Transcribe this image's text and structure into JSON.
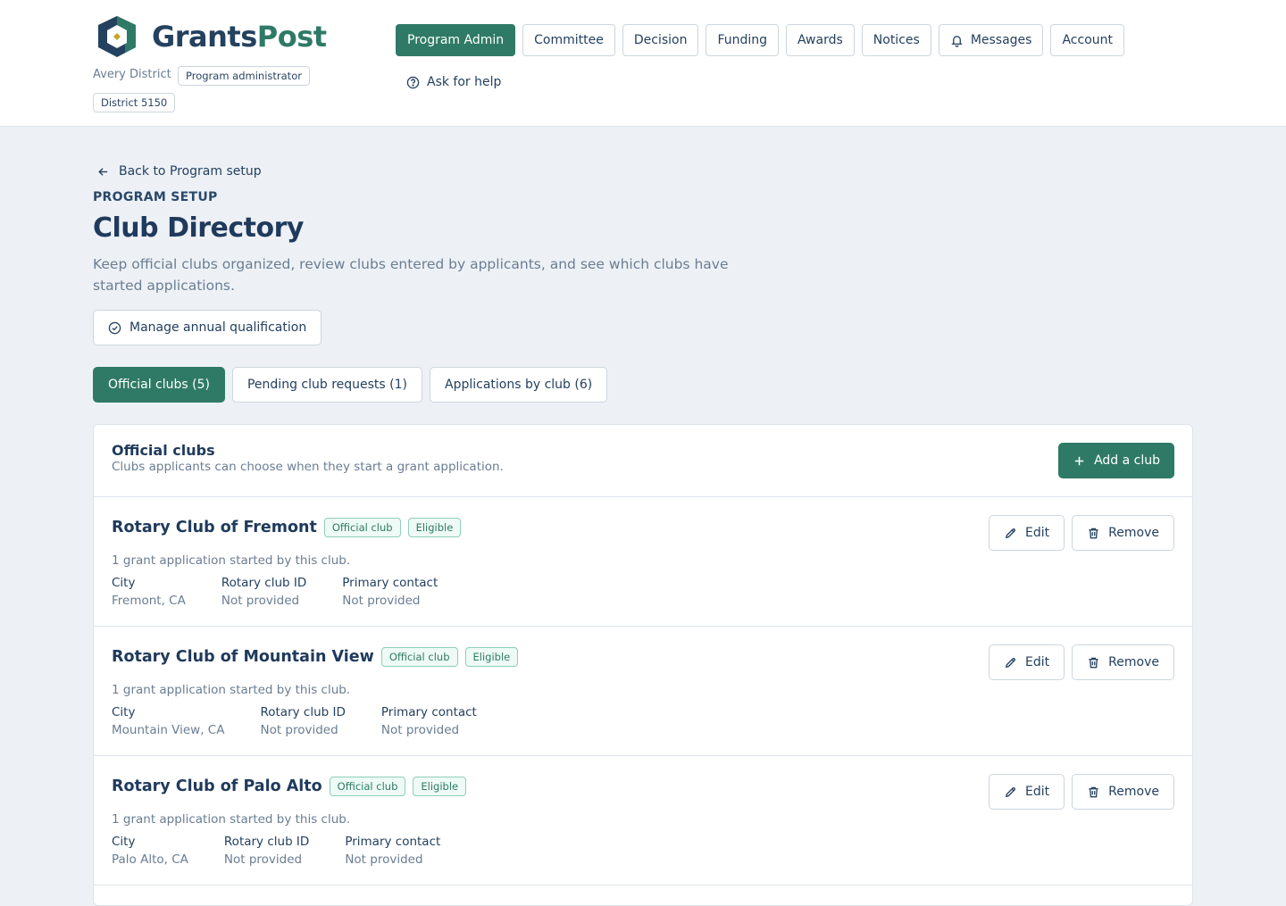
{
  "brand": {
    "name_part1": "Grants",
    "name_part2": "Post",
    "accent": "#2f7a66",
    "dark": "#24425f"
  },
  "user": {
    "district_name": "Avery District",
    "role": "Program administrator",
    "district_id": "District 5150"
  },
  "nav": {
    "items": [
      {
        "label": "Program Admin",
        "active": true
      },
      {
        "label": "Committee"
      },
      {
        "label": "Decision"
      },
      {
        "label": "Funding"
      },
      {
        "label": "Awards"
      },
      {
        "label": "Notices"
      },
      {
        "label": "Messages",
        "icon": "bell-icon"
      },
      {
        "label": "Account"
      }
    ],
    "help_label": "Ask for help"
  },
  "page": {
    "back_label": "Back to Program setup",
    "eyebrow": "PROGRAM SETUP",
    "title": "Club Directory",
    "subtitle": "Keep official clubs organized, review clubs entered by applicants, and see which clubs have started applications.",
    "qualification_button": "Manage annual qualification"
  },
  "tabs": [
    {
      "label": "Official clubs (5)",
      "active": true
    },
    {
      "label": "Pending club requests (1)"
    },
    {
      "label": "Applications by club (6)"
    }
  ],
  "official_clubs": {
    "title": "Official clubs",
    "subtitle": "Clubs applicants can choose when they start a grant application.",
    "add_button": "Add a club",
    "field_labels": {
      "city": "City",
      "club_id": "Rotary club ID",
      "contact": "Primary contact"
    },
    "edit_label": "Edit",
    "remove_label": "Remove",
    "clubs": [
      {
        "name": "Rotary Club of Fremont",
        "badges": [
          "Official club",
          "Eligible"
        ],
        "applications": "1 grant application started by this club.",
        "city": "Fremont, CA",
        "club_id": "Not provided",
        "contact": "Not provided"
      },
      {
        "name": "Rotary Club of Mountain View",
        "badges": [
          "Official club",
          "Eligible"
        ],
        "applications": "1 grant application started by this club.",
        "city": "Mountain View, CA",
        "club_id": "Not provided",
        "contact": "Not provided"
      },
      {
        "name": "Rotary Club of Palo Alto",
        "badges": [
          "Official club",
          "Eligible"
        ],
        "applications": "1 grant application started by this club.",
        "city": "Palo Alto, CA",
        "club_id": "Not provided",
        "contact": "Not provided"
      }
    ]
  }
}
